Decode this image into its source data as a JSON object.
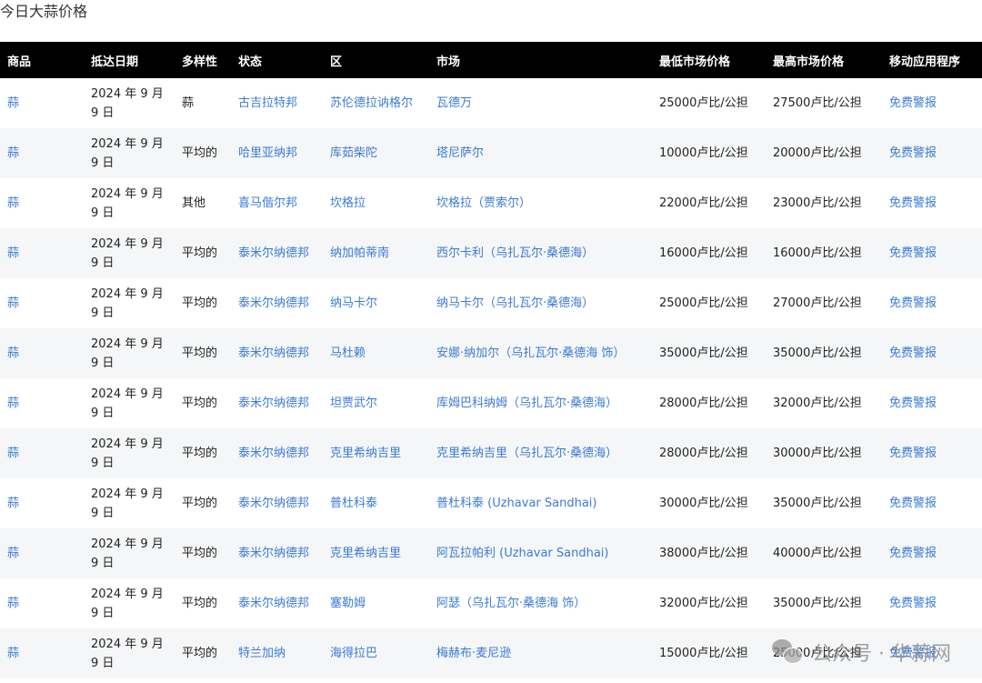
{
  "page": {
    "title": "今日大蒜价格"
  },
  "table": {
    "headers": [
      "商品",
      "抵达日期",
      "多样性",
      "状态",
      "区",
      "市场",
      "最低市场价格",
      "最高市场价格",
      "移动应用程序"
    ],
    "rows": [
      {
        "commodity": "蒜",
        "date": "2024 年 9 月 9 日",
        "variety": "蒜",
        "state": "古吉拉特邦",
        "district": "苏伦德拉讷格尔",
        "market": "瓦德万",
        "min_price": "25000卢比/公担",
        "max_price": "27500卢比/公担",
        "app": "免费警报"
      },
      {
        "commodity": "蒜",
        "date": "2024 年 9 月 9 日",
        "variety": "平均的",
        "state": "哈里亚纳邦",
        "district": "库茹柴陀",
        "market": "塔尼萨尔",
        "min_price": "10000卢比/公担",
        "max_price": "20000卢比/公担",
        "app": "免费警报"
      },
      {
        "commodity": "蒜",
        "date": "2024 年 9 月 9 日",
        "variety": "其他",
        "state": "喜马偕尔邦",
        "district": "坎格拉",
        "market": "坎格拉（贾索尔）",
        "min_price": "22000卢比/公担",
        "max_price": "23000卢比/公担",
        "app": "免费警报"
      },
      {
        "commodity": "蒜",
        "date": "2024 年 9 月 9 日",
        "variety": "平均的",
        "state": "泰米尔纳德邦",
        "district": "纳加帕蒂南",
        "market": "西尔卡利（乌扎瓦尔·桑德海）",
        "min_price": "16000卢比/公担",
        "max_price": "16000卢比/公担",
        "app": "免费警报"
      },
      {
        "commodity": "蒜",
        "date": "2024 年 9 月 9 日",
        "variety": "平均的",
        "state": "泰米尔纳德邦",
        "district": "纳马卡尔",
        "market": "纳马卡尔（乌扎瓦尔·桑德海）",
        "min_price": "25000卢比/公担",
        "max_price": "27000卢比/公担",
        "app": "免费警报"
      },
      {
        "commodity": "蒜",
        "date": "2024 年 9 月 9 日",
        "variety": "平均的",
        "state": "泰米尔纳德邦",
        "district": "马杜赖",
        "market": "安娜·纳加尔（乌扎瓦尔·桑德海 饰）",
        "min_price": "35000卢比/公担",
        "max_price": "35000卢比/公担",
        "app": "免费警报"
      },
      {
        "commodity": "蒜",
        "date": "2024 年 9 月 9 日",
        "variety": "平均的",
        "state": "泰米尔纳德邦",
        "district": "坦贾武尔",
        "market": "库姆巴科纳姆（乌扎瓦尔·桑德海）",
        "min_price": "28000卢比/公担",
        "max_price": "32000卢比/公担",
        "app": "免费警报"
      },
      {
        "commodity": "蒜",
        "date": "2024 年 9 月 9 日",
        "variety": "平均的",
        "state": "泰米尔纳德邦",
        "district": "克里希纳吉里",
        "market": "克里希纳吉里（乌扎瓦尔·桑德海）",
        "min_price": "28000卢比/公担",
        "max_price": "30000卢比/公担",
        "app": "免费警报"
      },
      {
        "commodity": "蒜",
        "date": "2024 年 9 月 9 日",
        "variety": "平均的",
        "state": "泰米尔纳德邦",
        "district": "普杜科泰",
        "market": "普杜科泰 (Uzhavar Sandhai)",
        "min_price": "30000卢比/公担",
        "max_price": "35000卢比/公担",
        "app": "免费警报"
      },
      {
        "commodity": "蒜",
        "date": "2024 年 9 月 9 日",
        "variety": "平均的",
        "state": "泰米尔纳德邦",
        "district": "克里希纳吉里",
        "market": "阿瓦拉帕利 (Uzhavar Sandhai)",
        "min_price": "38000卢比/公担",
        "max_price": "40000卢比/公担",
        "app": "免费警报"
      },
      {
        "commodity": "蒜",
        "date": "2024 年 9 月 9 日",
        "variety": "平均的",
        "state": "泰米尔纳德邦",
        "district": "塞勒姆",
        "market": "阿瑟（乌扎瓦尔·桑德海 饰）",
        "min_price": "32000卢比/公担",
        "max_price": "35000卢比/公担",
        "app": "免费警报"
      },
      {
        "commodity": "蒜",
        "date": "2024 年 9 月 9 日",
        "variety": "平均的",
        "state": "特兰加纳",
        "district": "海得拉巴",
        "market": "梅赫布·麦尼逊",
        "min_price": "15000卢比/公担",
        "max_price": "25000卢比/公担",
        "app": "免费警报"
      }
    ]
  },
  "watermark": {
    "text": "公众号 · 华蒜网",
    "icon": "wechat-icon"
  }
}
